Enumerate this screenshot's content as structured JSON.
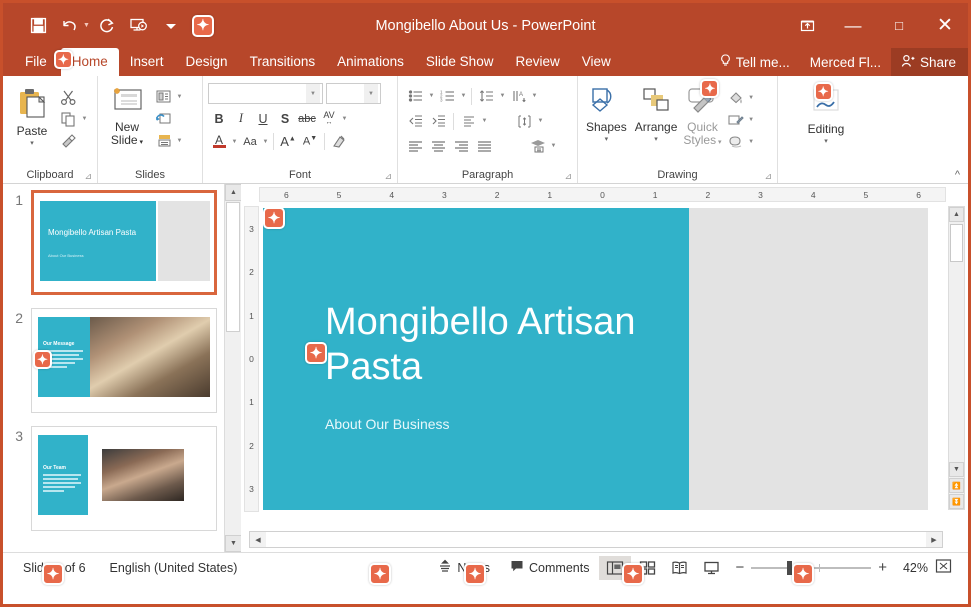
{
  "window": {
    "title": "Mongibello About Us - PowerPoint",
    "restore_icon": "restore-down-icon",
    "minimize_label": "—",
    "maximize_label": "□",
    "close_label": "✕"
  },
  "quick_access": [
    {
      "name": "save-icon",
      "label": "Save"
    },
    {
      "name": "undo-icon",
      "label": "Undo"
    },
    {
      "name": "redo-icon",
      "label": "Redo"
    },
    {
      "name": "start-slideshow-icon",
      "label": "Start From Beginning"
    },
    {
      "name": "customize-qat-icon",
      "label": "Customize Quick Access Toolbar"
    }
  ],
  "tabs": [
    {
      "label": "File",
      "active": false
    },
    {
      "label": "Home",
      "active": true
    },
    {
      "label": "Insert",
      "active": false
    },
    {
      "label": "Design",
      "active": false
    },
    {
      "label": "Transitions",
      "active": false
    },
    {
      "label": "Animations",
      "active": false
    },
    {
      "label": "Slide Show",
      "active": false
    },
    {
      "label": "Review",
      "active": false
    },
    {
      "label": "View",
      "active": false
    }
  ],
  "tellme": {
    "label": "Tell me...",
    "icon": "lightbulb-icon"
  },
  "user": {
    "name": "Merced Fl..."
  },
  "share": {
    "label": "Share",
    "icon": "share-person-icon"
  },
  "ribbon": {
    "groups": [
      {
        "name": "Clipboard",
        "big_button": {
          "label": "Paste",
          "caret": "▾"
        },
        "small_buttons": [
          {
            "name": "cut-icon",
            "label": "Cut"
          },
          {
            "name": "copy-icon",
            "label": "Copy"
          },
          {
            "name": "format-painter-icon",
            "label": "Format Painter"
          }
        ]
      },
      {
        "name": "Slides",
        "big_button": {
          "label": "New\nSlide",
          "line1": "New",
          "line2": "Slide",
          "caret": "▾"
        },
        "small_buttons": [
          {
            "name": "slide-layout-icon",
            "label": "Layout"
          },
          {
            "name": "reset-slide-icon",
            "label": "Reset"
          },
          {
            "name": "section-icon",
            "label": "Section"
          }
        ]
      },
      {
        "name": "Font",
        "font_name_value": "",
        "font_size_value": "",
        "buttons_row1": [
          "B",
          "I",
          "U",
          "S",
          "abc",
          "AV"
        ],
        "buttons_row2": [
          "A",
          "Aa",
          "A↑",
          "A↓",
          "clear-formatting"
        ]
      },
      {
        "name": "Paragraph",
        "buttons": [
          "bullets",
          "numbering",
          "line-spacing",
          "text-direction",
          "decrease-indent",
          "increase-indent",
          "align-text",
          "convert-smartart",
          "align-left",
          "align-center",
          "align-right",
          "justify"
        ]
      },
      {
        "name": "Drawing",
        "big_buttons": [
          {
            "label": "Shapes",
            "caret": "▾"
          },
          {
            "label": "Arrange",
            "caret": "▾"
          },
          {
            "line1": "Quick",
            "line2": "Styles",
            "caret": "▾"
          }
        ],
        "small_buttons": [
          {
            "name": "shape-fill-icon",
            "label": "Shape Fill"
          },
          {
            "name": "shape-outline-icon",
            "label": "Shape Outline"
          },
          {
            "name": "shape-effects-icon",
            "label": "Shape Effects"
          }
        ]
      },
      {
        "name": "Editing",
        "big_button": {
          "label": "Editing",
          "caret": "▾"
        }
      }
    ],
    "collapse_label": "^"
  },
  "thumbnails": [
    {
      "number": "1",
      "selected": true,
      "title": "Mongibello Artisan Pasta",
      "subtitle": "About Our Business",
      "layout": "title-left-teal"
    },
    {
      "number": "2",
      "selected": false,
      "title": "Our Message",
      "layout": "teal-block-with-photo",
      "photo": "pasta-making-hands"
    },
    {
      "number": "3",
      "selected": false,
      "title": "Our Team",
      "layout": "teal-block-with-photo",
      "photo": "people-at-table"
    }
  ],
  "ruler": {
    "horizontal": [
      "6",
      "5",
      "4",
      "3",
      "2",
      "1",
      "0",
      "1",
      "2",
      "3",
      "4",
      "5",
      "6"
    ],
    "vertical": [
      "3",
      "2",
      "1",
      "0",
      "1",
      "2",
      "3"
    ]
  },
  "slide": {
    "title": "Mongibello Artisan Pasta",
    "subtitle": "About Our Business",
    "accent_color": "#31b2c9",
    "title_color": "#ffffff"
  },
  "status": {
    "slide_counter": "Slide 1 of 6",
    "language": "English (United States)",
    "notes_label": "Notes",
    "comments_label": "Comments",
    "views": [
      {
        "name": "normal-view",
        "label": "Normal",
        "active": true
      },
      {
        "name": "slide-sorter-view",
        "label": "Slide Sorter",
        "active": false
      },
      {
        "name": "reading-view",
        "label": "Reading View",
        "active": false
      },
      {
        "name": "slide-show-view",
        "label": "Slide Show",
        "active": false
      }
    ],
    "zoom_out_label": "−",
    "zoom_in_label": "+",
    "zoom_percent": "42%",
    "fit_label": "Fit slide to current window"
  },
  "markers": {
    "glyph": "✦"
  },
  "colors": {
    "ribbon_red": "#b7472a",
    "accent_teal": "#31b2c9",
    "marker_orange": "#e8694a",
    "selection_orange": "#d9663d"
  }
}
